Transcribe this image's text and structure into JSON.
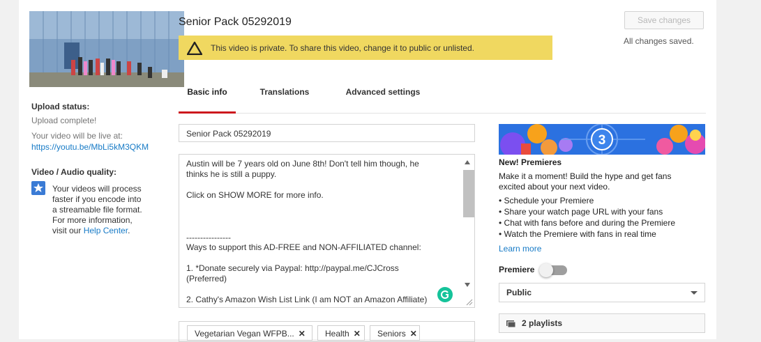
{
  "video": {
    "title": "Senior Pack 05292019",
    "warning": "This video is private. To share this video, change it to public or unlisted."
  },
  "actions": {
    "save_label": "Save changes",
    "saved_status": "All changes saved."
  },
  "upload": {
    "status_label": "Upload status:",
    "status_value": "Upload complete!",
    "live_label": "Your video will be live at:",
    "url": "https://youtu.be/MbLi5kM3QKM"
  },
  "quality": {
    "label": "Video / Audio quality:",
    "line1": "Your videos will process",
    "line2": "faster if you encode into",
    "line3": "a streamable file format.",
    "line4": "For more information,",
    "line5_prefix": "visit our ",
    "line5_link": "Help Center",
    "line5_suffix": "."
  },
  "tabs": [
    {
      "label": "Basic info",
      "active": true
    },
    {
      "label": "Translations",
      "active": false
    },
    {
      "label": "Advanced settings",
      "active": false
    }
  ],
  "form": {
    "title_value": "Senior Pack 05292019",
    "description_lines": [
      "Austin will be 7 years old on June 8th!  Don't tell him though, he",
      "thinks he is still a puppy.",
      "",
      "Click on SHOW MORE for more info.",
      "",
      "",
      "",
      "----------------",
      "Ways to support this AD-FREE and NON-AFFILIATED channel:",
      "",
      "1.  *Donate securely via Paypal: http://paypal.me/CJCross",
      "(Preferred)",
      "",
      "2.  Cathy's Amazon Wish List Link  (I am NOT an Amazon Affiliate)"
    ],
    "tags": [
      "Vegetarian Vegan WFPB...",
      "Health",
      "Seniors"
    ]
  },
  "premieres": {
    "banner_number": "3",
    "heading": "New! Premieres",
    "intro_line1": "Make it a moment! Build the hype and get fans",
    "intro_line2": "excited about your next video.",
    "bullets": [
      "• Schedule your Premiere",
      "• Share your watch page URL with your fans",
      "• Chat with fans before and during the Premiere",
      "• Watch the Premiere with fans in real time"
    ],
    "learn_more": "Learn more",
    "premiere_label": "Premiere",
    "premiere_enabled": false
  },
  "visibility": {
    "selected": "Public"
  },
  "playlists": {
    "label": "2 playlists"
  },
  "colors": {
    "accent_red": "#cc181e",
    "link_blue": "#167ac6",
    "warning_yellow": "#f0d860",
    "banner_blue": "#2b71e0"
  }
}
